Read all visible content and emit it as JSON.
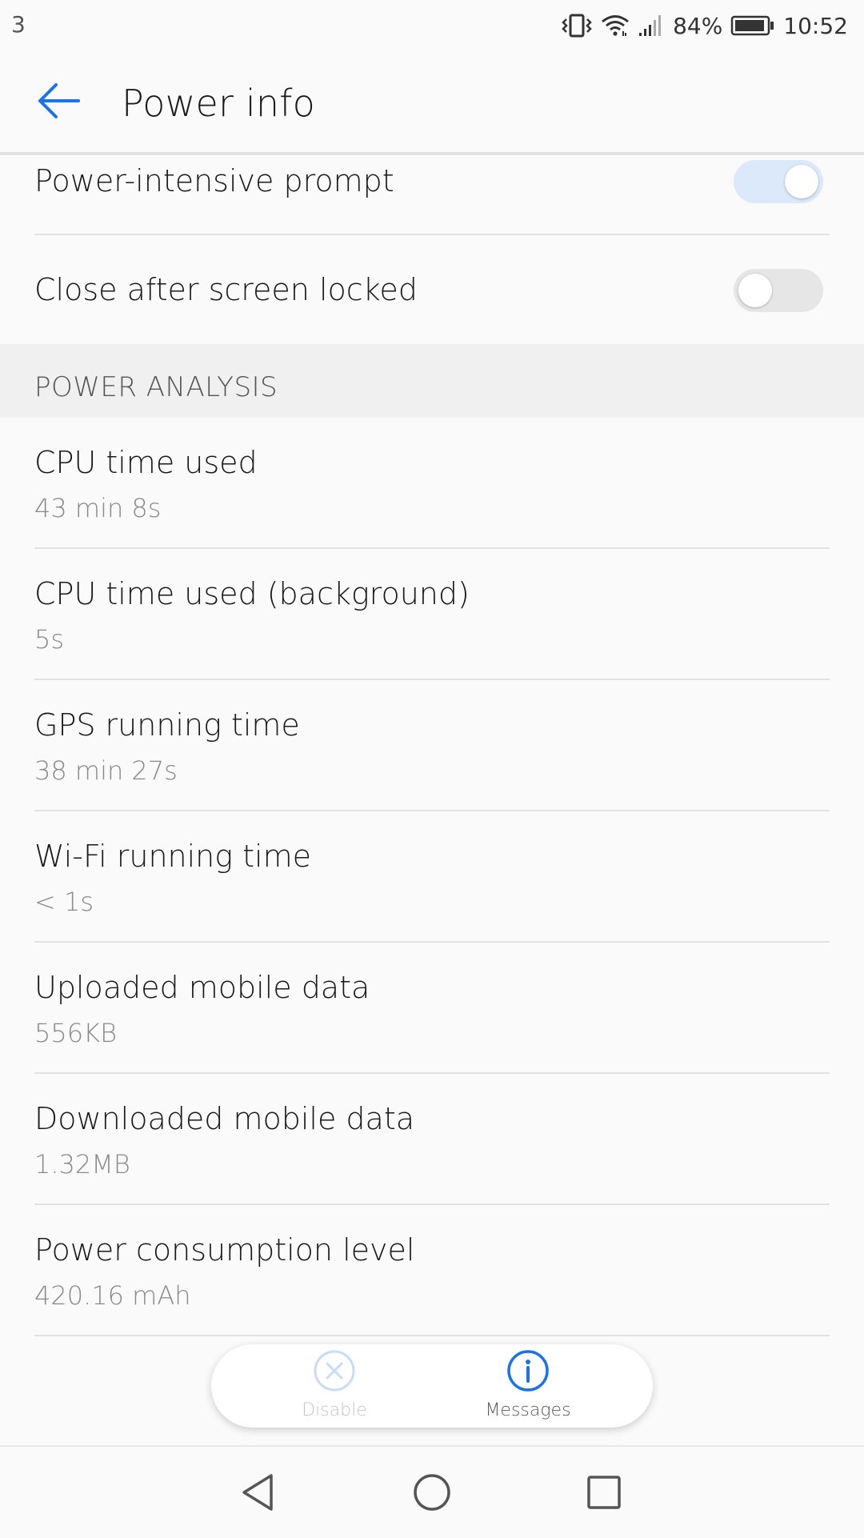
{
  "status_bar": {
    "notification_count": "3",
    "battery_percent": "84%",
    "time": "10:52",
    "icons": [
      "vibrate-icon",
      "wifi-icon",
      "signal-icon",
      "battery-icon"
    ]
  },
  "app_bar": {
    "title": "Power info",
    "back_icon": "arrow-left-icon",
    "accent_color": "#1a73e8"
  },
  "toggles": [
    {
      "label": "Power-intensive prompt",
      "state": "on"
    },
    {
      "label": "Close after screen locked",
      "state": "off"
    }
  ],
  "section": {
    "header": "POWER ANALYSIS"
  },
  "power_analysis": [
    {
      "title": "CPU time used",
      "value": "43 min 8s"
    },
    {
      "title": "CPU time used (background)",
      "value": "5s"
    },
    {
      "title": "GPS running time",
      "value": "38 min 27s"
    },
    {
      "title": "Wi-Fi running time",
      "value": "< 1s"
    },
    {
      "title": "Uploaded mobile data",
      "value": "556KB"
    },
    {
      "title": "Downloaded mobile data",
      "value": "1.32MB"
    },
    {
      "title": "Power consumption level",
      "value": "420.16 mAh"
    }
  ],
  "floating_bar": {
    "disable_label": "Disable",
    "disable_icon": "close-circle-icon",
    "disable_enabled": false,
    "messages_label": "Messages",
    "messages_icon": "info-circle-icon"
  },
  "nav_bar": {
    "buttons": [
      "back-triangle-icon",
      "home-circle-icon",
      "recents-square-icon"
    ]
  }
}
